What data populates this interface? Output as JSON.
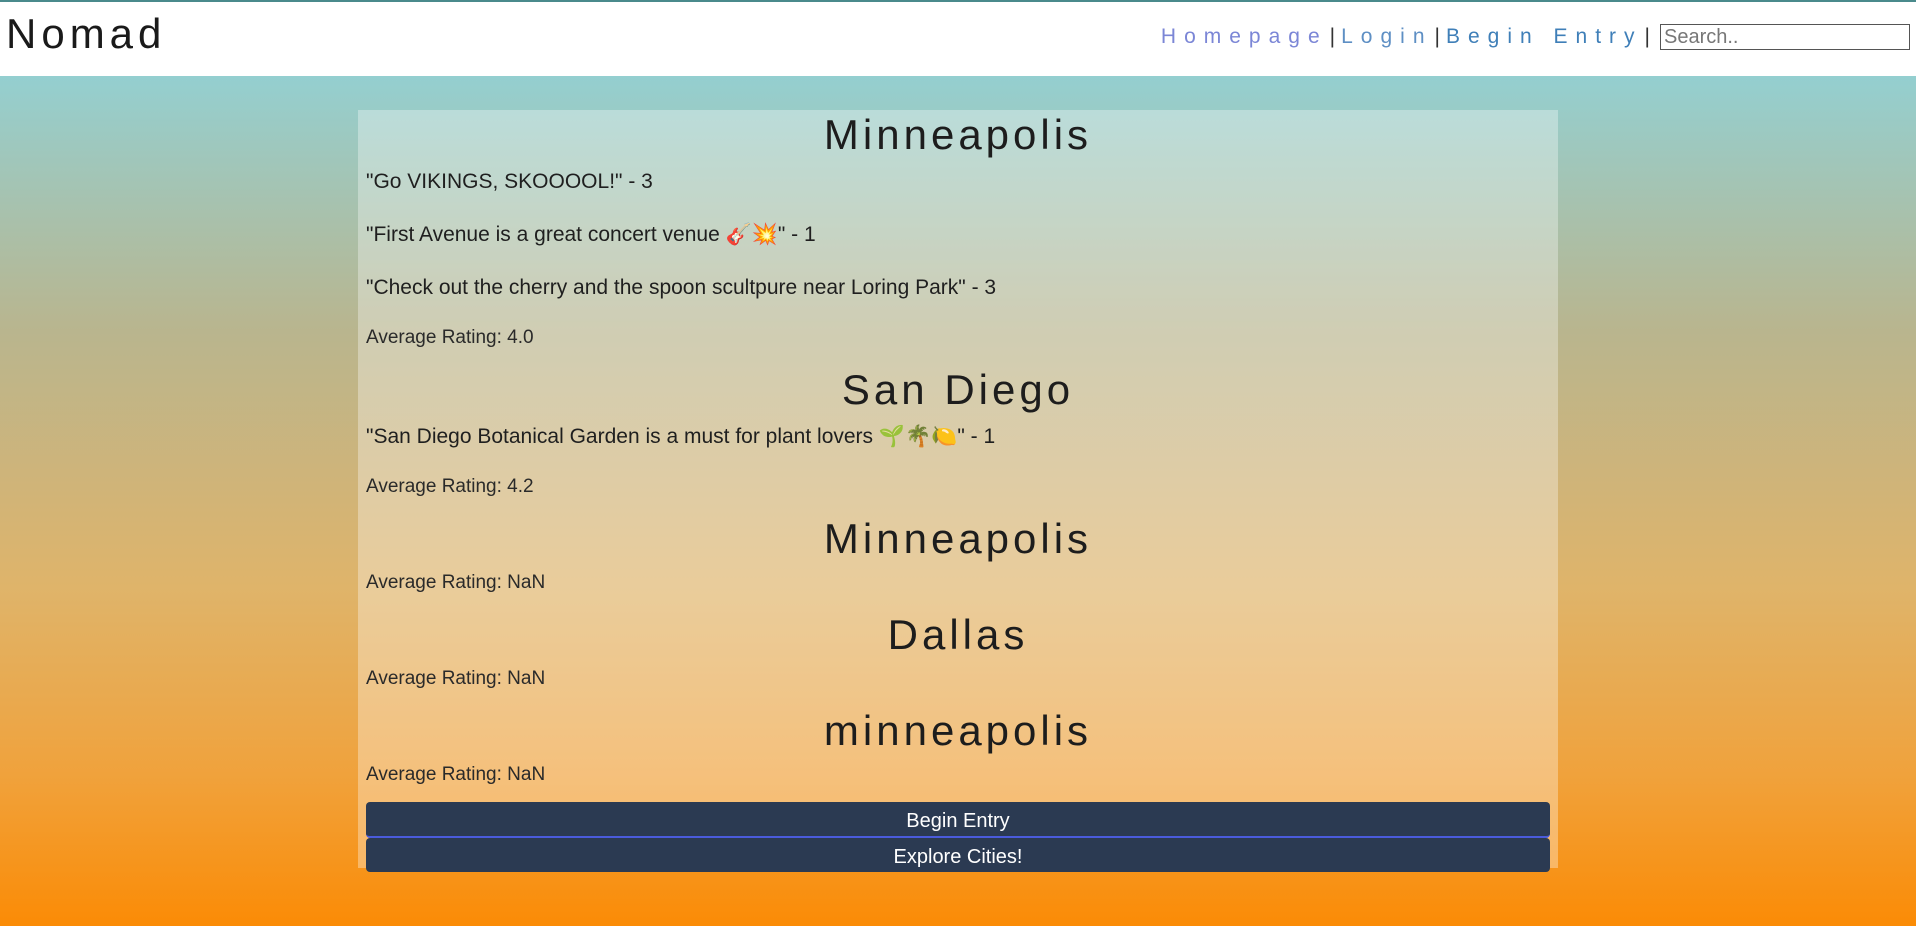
{
  "header": {
    "brand": "Nomad",
    "nav": {
      "home": "Homepage",
      "login": "Login",
      "begin_entry": "Begin Entry",
      "separator": "|"
    },
    "search_placeholder": "Search.."
  },
  "cities": [
    {
      "name": "Minneapolis",
      "comments": [
        "\"Go VIKINGS, SKOOOOL!\" - 3",
        "\"First Avenue is a great concert venue 🎸💥\" - 1",
        "\"Check out the cherry and the spoon scultpure near Loring Park\" - 3"
      ],
      "average": "Average Rating: 4.0"
    },
    {
      "name": "San Diego",
      "comments": [
        "\"San Diego Botanical Garden is a must for plant lovers 🌱🌴🍋\" - 1"
      ],
      "average": "Average Rating: 4.2"
    },
    {
      "name": "Minneapolis",
      "comments": [],
      "average": "Average Rating: NaN"
    },
    {
      "name": "Dallas",
      "comments": [],
      "average": "Average Rating: NaN"
    },
    {
      "name": "minneapolis",
      "comments": [],
      "average": "Average Rating: NaN"
    }
  ],
  "buttons": {
    "begin_entry": "Begin Entry",
    "explore": "Explore Cities!"
  },
  "colors": {
    "button_bg": "#2b3a52",
    "gradient_top": "#94cfd0",
    "gradient_bottom": "#fb8b05"
  }
}
